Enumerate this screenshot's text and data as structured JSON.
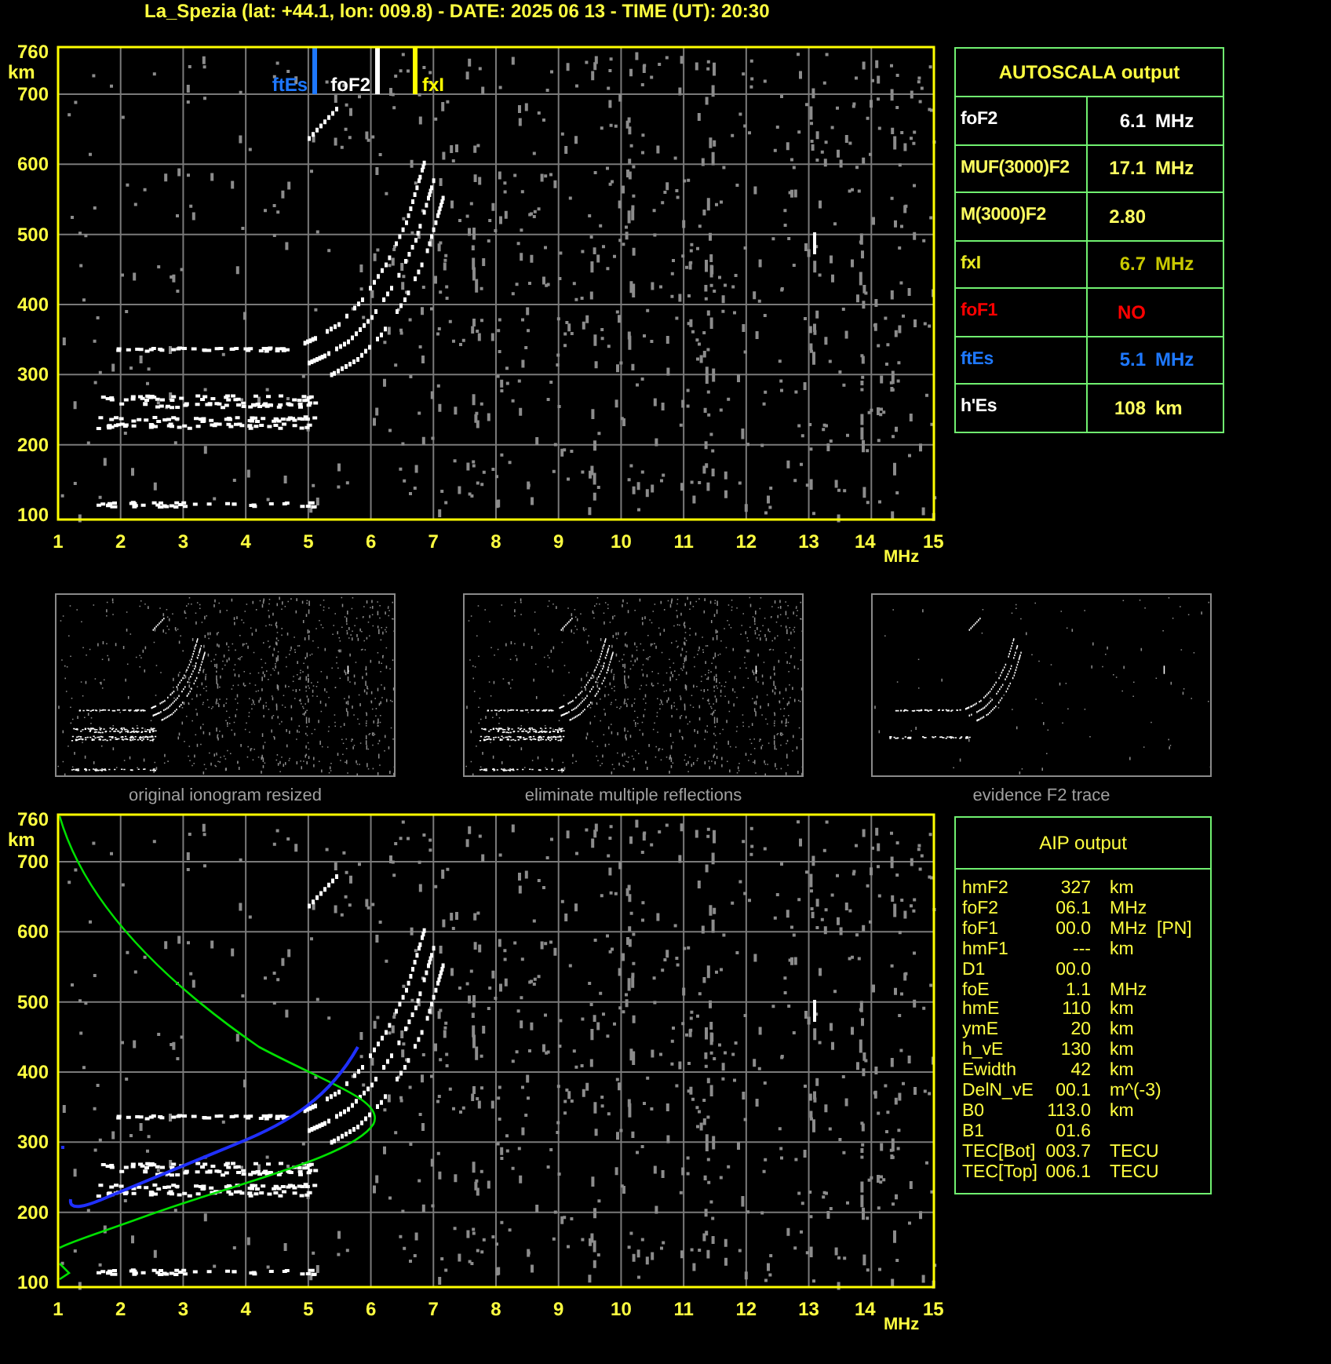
{
  "title": "La_Spezia (lat: +44.1, lon: 009.8) - DATE: 2025 06 13 - TIME (UT): 20:30",
  "ionogram": {
    "y_unit": "km",
    "y_ticks": [
      "760",
      "700",
      "600",
      "500",
      "400",
      "300",
      "200",
      "100"
    ],
    "x_ticks": [
      "1",
      "2",
      "3",
      "4",
      "5",
      "6",
      "7",
      "8",
      "9",
      "10",
      "11",
      "12",
      "13",
      "14"
    ],
    "x_unit": "MHz",
    "x_end": "15",
    "markers": [
      {
        "label": "ftEs",
        "color": "#1e78ff"
      },
      {
        "label": "foF2",
        "color": "#ffffff"
      },
      {
        "label": "fxI",
        "color": "#ffff00"
      }
    ]
  },
  "autoscala": {
    "title": "AUTOSCALA output",
    "rows": [
      {
        "name": "foF2",
        "value": "6.1",
        "unit": "MHz"
      },
      {
        "name": "MUF(3000)F2",
        "value": "17.1",
        "unit": "MHz"
      },
      {
        "name": "M(3000)F2",
        "value": "2.80"
      },
      {
        "name": "fxI",
        "value": "6.7",
        "unit": "MHz"
      },
      {
        "name": "foF1",
        "value": "NO"
      },
      {
        "name": "ftEs",
        "value": "5.1",
        "unit": "MHz"
      },
      {
        "name": "h'Es",
        "value": "108",
        "unit": "km"
      }
    ]
  },
  "thumbnails": [
    {
      "caption": "original ionogram resized",
      "kind": "full"
    },
    {
      "caption": "eliminate multiple reflections",
      "kind": "full"
    },
    {
      "caption": "evidence F2 trace",
      "kind": "trace"
    }
  ],
  "profile_plot": {
    "y_unit": "km",
    "y_ticks": [
      "760",
      "700",
      "600",
      "500",
      "400",
      "300",
      "200",
      "100"
    ],
    "x_ticks": [
      "1",
      "2",
      "3",
      "4",
      "5",
      "6",
      "7",
      "8",
      "9",
      "10",
      "11",
      "12",
      "13",
      "14"
    ],
    "x_unit": "MHz",
    "x_end": "15"
  },
  "aip": {
    "title": "AIP output",
    "rows": [
      {
        "name": "hmF2",
        "value": "327",
        "unit": "km"
      },
      {
        "name": "foF2",
        "value": "06.1",
        "unit": "MHz"
      },
      {
        "name": "foF1",
        "value": "00.0",
        "unit": "MHz",
        "flag": "[PN]"
      },
      {
        "name": "hmF1",
        "value": "---",
        "unit": "km"
      },
      {
        "name": "D1",
        "value": "00.0"
      },
      {
        "name": "foE",
        "value": "1.1",
        "unit": "MHz"
      },
      {
        "name": "hmE",
        "value": "110",
        "unit": "km"
      },
      {
        "name": "ymE",
        "value": "20",
        "unit": "km"
      },
      {
        "name": "h_vE",
        "value": "130",
        "unit": "km"
      },
      {
        "name": "Ewidth",
        "value": "42",
        "unit": "km"
      },
      {
        "name": "DelN_vE",
        "value": "00.1",
        "unit": "m^(-3)"
      },
      {
        "name": "B0",
        "value": "113.0",
        "unit": "km"
      },
      {
        "name": "B1",
        "value": "01.6"
      },
      {
        "name": "TEC[Bot]",
        "value": "003.7",
        "unit": "TECU"
      },
      {
        "name": "TEC[Top]",
        "value": "006.1",
        "unit": "TECU"
      }
    ]
  }
}
